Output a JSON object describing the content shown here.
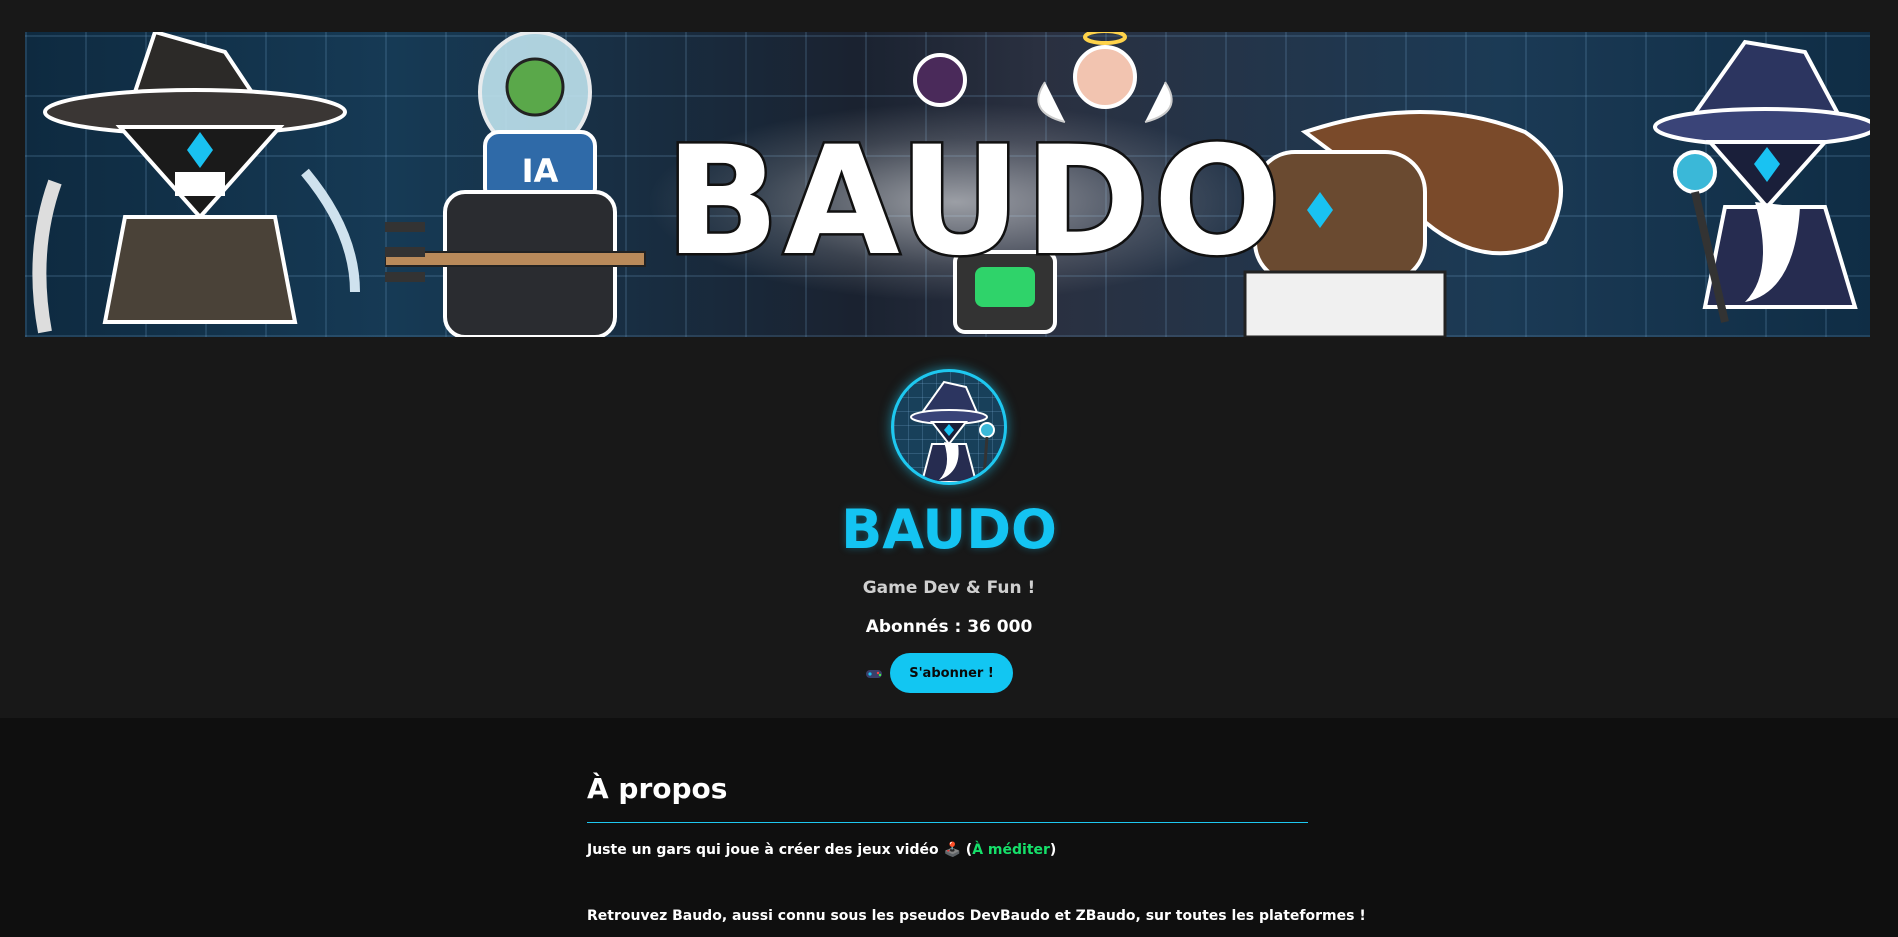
{
  "banner": {
    "title": "BAUDO",
    "label_ia": "IA"
  },
  "channel": {
    "name": "BAUDO",
    "tagline": "Game Dev & Fun !",
    "subscribers": "Abonnés : 36 000",
    "subscribe_label": "S'abonner !",
    "subscribe_icon": "gamepad-icon"
  },
  "about": {
    "title": "À propos",
    "line1_prefix": "Juste un gars qui joue à créer des jeux vidéo 🕹️ (",
    "line1_link": "À méditer",
    "line1_suffix": ")",
    "line2": "Retrouvez Baudo, aussi connu sous les pseudos DevBaudo et ZBaudo, sur toutes les plateformes !"
  },
  "colors": {
    "accent": "#14c4f2",
    "link": "#16e06a",
    "background": "#181818",
    "section_bg": "#0f0f0f"
  }
}
